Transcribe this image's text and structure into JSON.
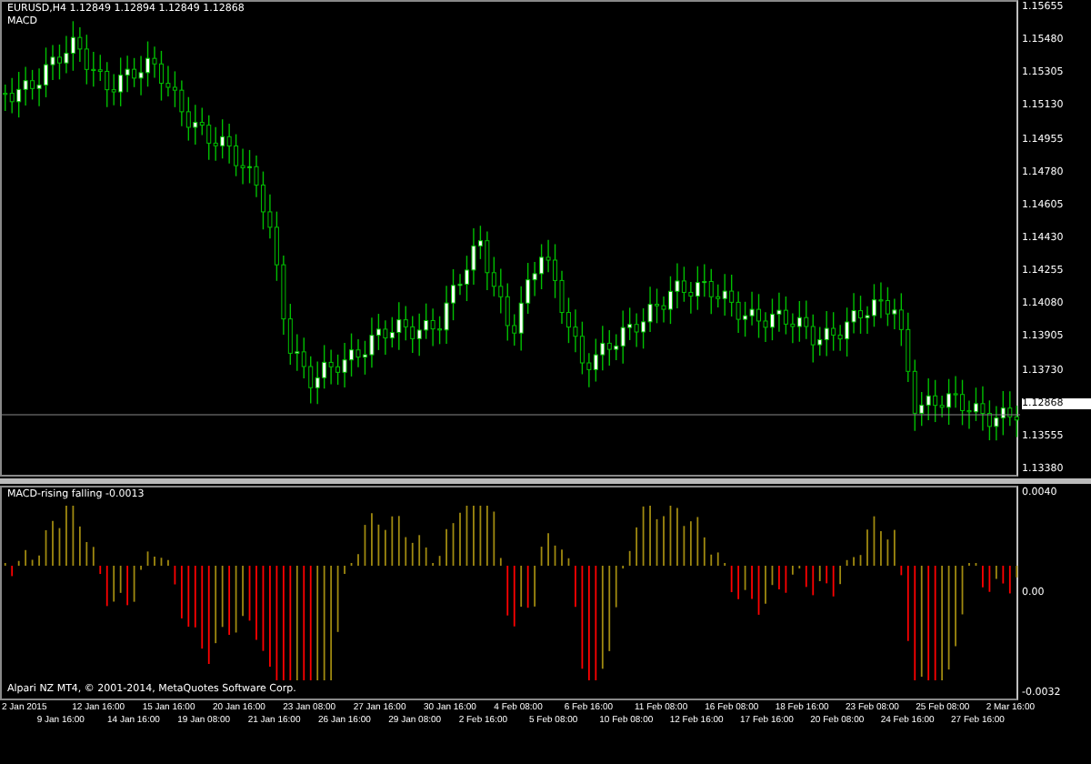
{
  "main_chart": {
    "header": "EURUSD,H4  1.12849 1.12894 1.12849 1.12868",
    "indicator_label": "MACD",
    "price_axis": [
      "1.15655",
      "1.15480",
      "1.15305",
      "1.15130",
      "1.14955",
      "1.14780",
      "1.14605",
      "1.14430",
      "1.14255",
      "1.14080",
      "1.13905",
      "1.13730",
      "1.13555",
      "1.13380"
    ],
    "current_price": "1.12868"
  },
  "indicator_panel": {
    "header": "MACD-rising falling -0.0013",
    "axis": [
      "0.0040",
      "0.00",
      "-0.0032"
    ],
    "copyright": "Alpari NZ MT4, © 2001-2014, MetaQuotes Software Corp."
  },
  "time_axis": [
    "2 Jan 2015",
    "9 Jan 16:00",
    "12 Jan 16:00",
    "14 Jan 16:00",
    "15 Jan 16:00",
    "19 Jan 08:00",
    "20 Jan 16:00",
    "21 Jan 16:00",
    "23 Jan 08:00",
    "26 Jan 16:00",
    "27 Jan 16:00",
    "29 Jan 08:00",
    "30 Jan 16:00",
    "2 Feb 16:00",
    "4 Feb 08:00",
    "5 Feb 08:00",
    "6 Feb 16:00",
    "10 Feb 08:00",
    "11 Feb 08:00",
    "12 Feb 16:00",
    "16 Feb 08:00",
    "17 Feb 16:00",
    "18 Feb 16:00",
    "20 Feb 08:00",
    "23 Feb 08:00",
    "24 Feb 16:00",
    "25 Feb 08:00",
    "27 Feb 16:00",
    "2 Mar 16:00"
  ]
}
